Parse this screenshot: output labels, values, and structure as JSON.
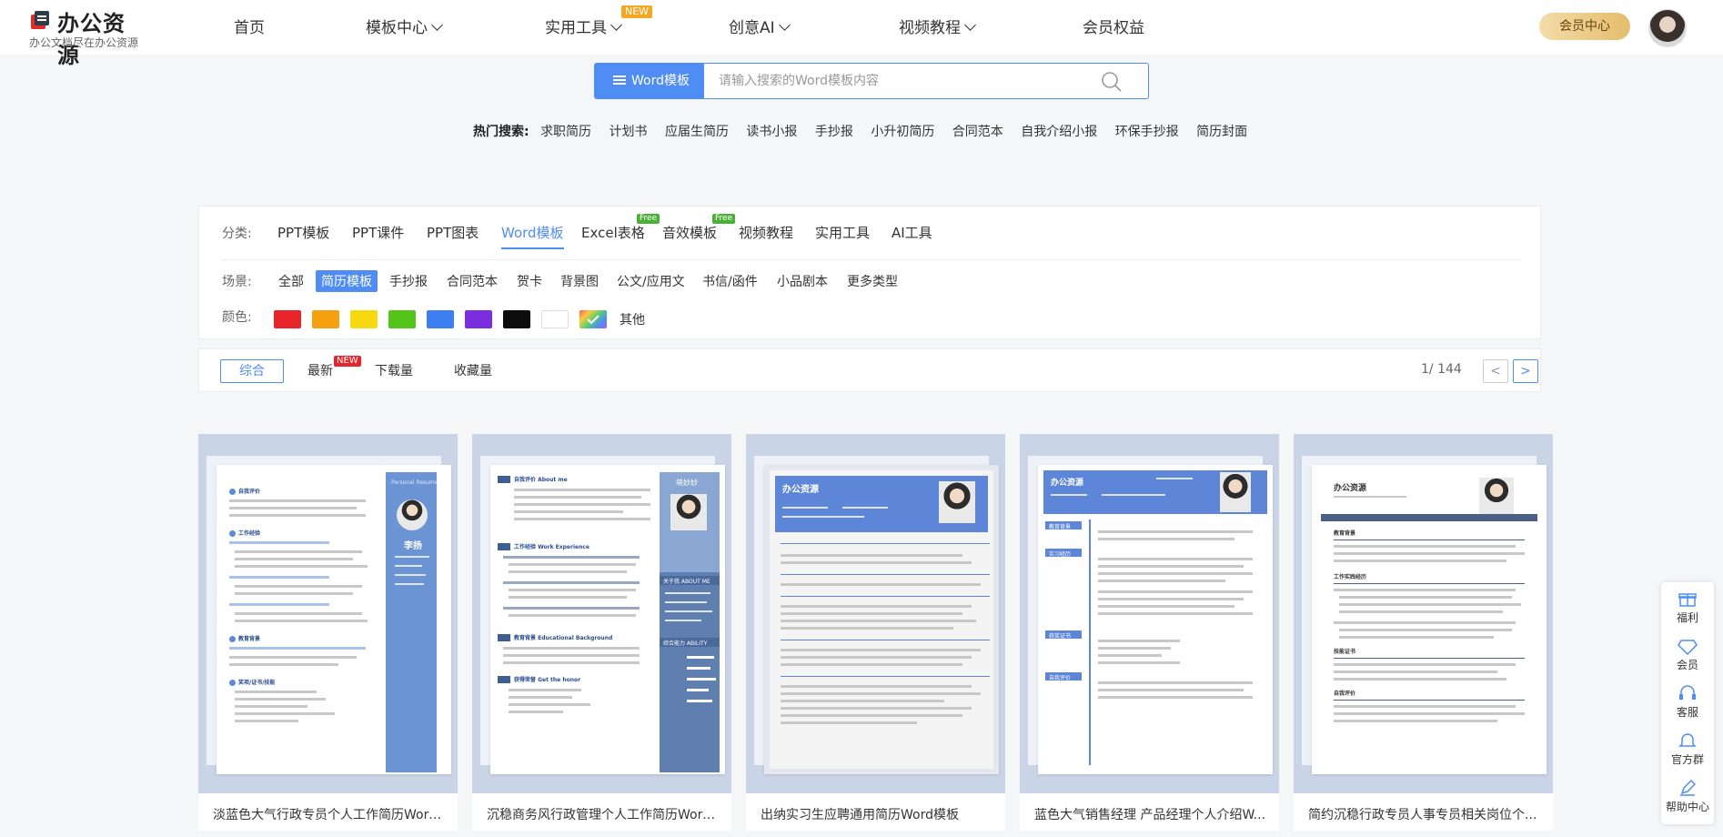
{
  "header": {
    "logo_title": "办公资源",
    "logo_sub": "办公文档尽在办公资源",
    "nav": [
      {
        "label": "首页"
      },
      {
        "label": "模板中心"
      },
      {
        "label": "实用工具",
        "badge": "NEW"
      },
      {
        "label": "创意AI"
      },
      {
        "label": "视频教程"
      },
      {
        "label": "会员权益"
      }
    ],
    "vip_button": "会员中心"
  },
  "search": {
    "type_label": "Word模板",
    "placeholder": "请输入搜索的Word模板内容"
  },
  "hot": {
    "label": "热门搜索:",
    "items": [
      "求职简历",
      "计划书",
      "应届生简历",
      "读书小报",
      "手抄报",
      "小升初简历",
      "合同范本",
      "自我介绍小报",
      "环保手抄报",
      "简历封面"
    ]
  },
  "filter": {
    "category_label": "分类:",
    "categories": [
      {
        "label": "PPT模板"
      },
      {
        "label": "PPT课件"
      },
      {
        "label": "PPT图表"
      },
      {
        "label": "Word模板"
      },
      {
        "label": "Excel表格",
        "badge": "Free"
      },
      {
        "label": "音效模板",
        "badge": "Free"
      },
      {
        "label": "视频教程"
      },
      {
        "label": "实用工具"
      },
      {
        "label": "AI工具"
      }
    ],
    "scene_label": "场景:",
    "scenes": [
      "全部",
      "简历模板",
      "手抄报",
      "合同范本",
      "贺卡",
      "背景图",
      "公文/应用文",
      "书信/函件",
      "小品剧本",
      "更多类型"
    ],
    "color_label": "颜色:",
    "colors": [
      "#e8262a",
      "#f5a00f",
      "#f8d90f",
      "#52c41a",
      "#3d7ff2",
      "#7a2ee0",
      "#0c0c0c",
      "#ffffff"
    ],
    "color_other": "其他"
  },
  "sort": {
    "options": [
      "综合",
      "最新",
      "下载量",
      "收藏量"
    ],
    "new_badge": "NEW",
    "pager": "1/ 144",
    "prev": "<",
    "next": ">"
  },
  "cards": [
    {
      "title": "淡蓝色大气行政专员个人工作简历Word...",
      "name": "李扬",
      "tagline": "Personal Resume",
      "sections": [
        "自我评价",
        "工作经验",
        "教育背景",
        "奖项/证书/技能"
      ]
    },
    {
      "title": "沉稳商务风行政管理个人工作简历Word...",
      "name": "萌妙妙",
      "sections": [
        "自我评价 About me",
        "工作经验 Work Experience",
        "教育背景 Educational Background",
        "获得荣誉 Get the honor"
      ],
      "side": [
        "关于我 ABOUT ME",
        "综合能力 ABILITY"
      ]
    },
    {
      "title": "出纳实习生应聘通用简历Word模板",
      "header": "办公资源"
    },
    {
      "title": "蓝色大气销售经理 产品经理个人介绍W...",
      "header": "办公资源",
      "sections": [
        "教育背景",
        "实习经历",
        "获奖证书",
        "自我评价"
      ]
    },
    {
      "title": "简约沉稳行政专员人事专员相关岗位个...",
      "header": "办公资源",
      "sections": [
        "教育背景",
        "工作实践经历",
        "技能证书",
        "自我评价"
      ]
    }
  ],
  "float_bar": [
    "福利",
    "会员",
    "客服",
    "官方群",
    "帮助中心"
  ]
}
